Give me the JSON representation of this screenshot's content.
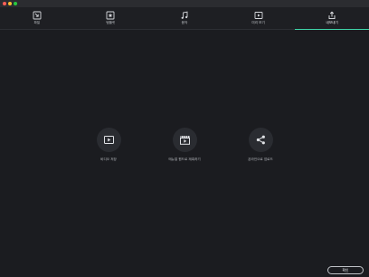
{
  "window": {
    "controls": [
      "close",
      "minimize",
      "zoom"
    ]
  },
  "tabs": [
    {
      "label": "파일",
      "icon": "file-import-icon",
      "active": false
    },
    {
      "label": "템플릿",
      "icon": "template-star-icon",
      "active": false
    },
    {
      "label": "음악",
      "icon": "music-note-icon",
      "active": false
    },
    {
      "label": "미리 보기",
      "icon": "preview-play-icon",
      "active": false
    },
    {
      "label": "내보내기",
      "icon": "export-share-icon",
      "active": true
    }
  ],
  "actions": [
    {
      "label": "비디오 저장",
      "icon": "video-save-icon"
    },
    {
      "label": "매뉴얼 원드로 재촉하기",
      "icon": "clapperboard-icon"
    },
    {
      "label": "온라인으로 업로드",
      "icon": "share-icon"
    }
  ],
  "footer": {
    "confirm_label": "확인"
  },
  "colors": {
    "accent": "#3fd3a8",
    "background": "#1b1c20"
  }
}
